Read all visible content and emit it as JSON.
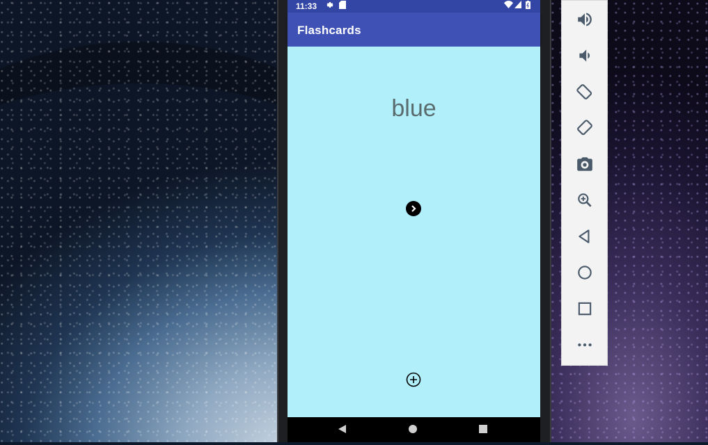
{
  "status_bar": {
    "time": "11:33",
    "icons": [
      "settings-icon",
      "sd-card-icon",
      "wifi-icon",
      "signal-icon",
      "battery-icon"
    ]
  },
  "app_bar": {
    "title": "Flashcards"
  },
  "card": {
    "word": "blue"
  },
  "buttons": {
    "next": "next-arrow-icon",
    "add": "add-circle-icon"
  },
  "nav_bar": [
    "back-icon",
    "home-icon",
    "recents-icon"
  ],
  "emulator_toolbar": [
    "volume-up-icon",
    "volume-down-icon",
    "rotate-left-icon",
    "rotate-right-icon",
    "screenshot-icon",
    "zoom-icon",
    "back-icon",
    "home-icon",
    "overview-icon",
    "more-icon"
  ],
  "colors": {
    "status_bar": "#3346a6",
    "app_bar": "#3f51b5",
    "card_background": "#b1effb",
    "word_text": "#5a6b6e",
    "toolbar_icon": "#4a5a6a"
  }
}
